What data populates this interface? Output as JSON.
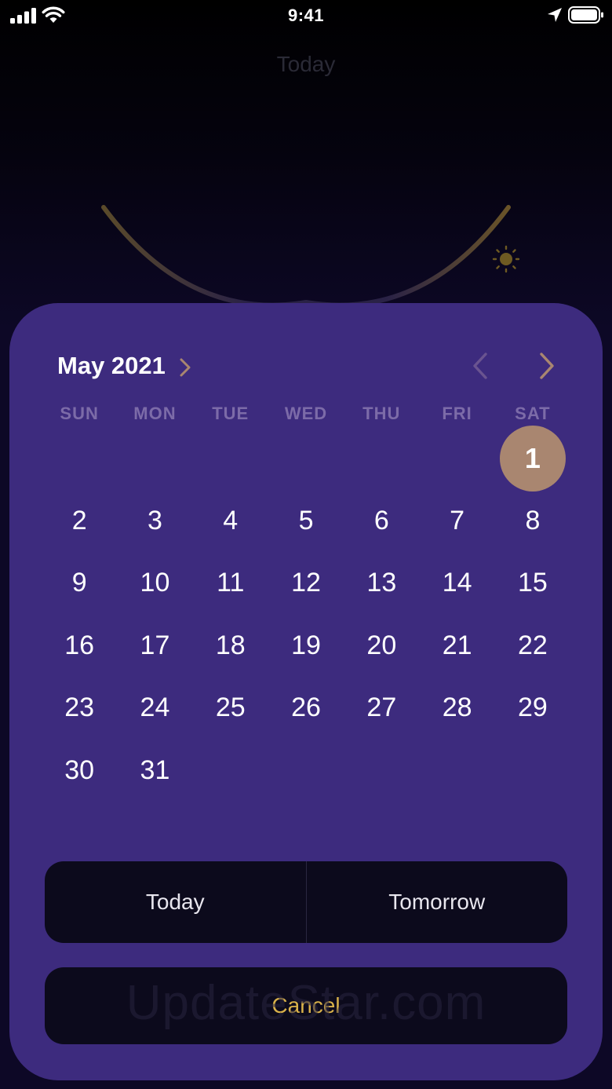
{
  "status_bar": {
    "time": "9:41"
  },
  "background": {
    "title": "Today"
  },
  "calendar": {
    "month_title": "May 2021",
    "weekdays": [
      "SUN",
      "MON",
      "TUE",
      "WED",
      "THU",
      "FRI",
      "SAT"
    ],
    "leading_blanks": 6,
    "days": [
      "1",
      "2",
      "3",
      "4",
      "5",
      "6",
      "7",
      "8",
      "9",
      "10",
      "11",
      "12",
      "13",
      "14",
      "15",
      "16",
      "17",
      "18",
      "19",
      "20",
      "21",
      "22",
      "23",
      "24",
      "25",
      "26",
      "27",
      "28",
      "29",
      "30",
      "31"
    ],
    "selected_day": "1"
  },
  "actions": {
    "today_label": "Today",
    "tomorrow_label": "Tomorrow",
    "cancel_label": "Cancel"
  },
  "watermark": "UpdateStar.com",
  "colors": {
    "sheet": "#3d2b7e",
    "selected_day": "#a98670",
    "cancel_text": "#d9b24a",
    "button_bg": "#0c0a1c",
    "weekday_text": "#7c6ba8"
  }
}
